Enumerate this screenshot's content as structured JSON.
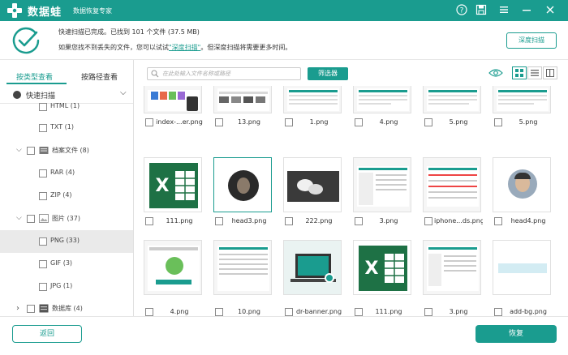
{
  "titlebar": {
    "app_name": "数据蛙",
    "subtitle": "数据恢复专家",
    "help_icon": "help-icon",
    "save_icon": "save-icon",
    "menu_icon": "menu-icon",
    "minimize_icon": "minimize-icon",
    "close_icon": "close-icon"
  },
  "status": {
    "line1": "快速扫描已完成。已找到 101 个文件 (37.5 MB)",
    "line2_prefix": "如果您找不到丢失的文件，您可以试试",
    "line2_link": "\"深度扫描\"",
    "line2_suffix": "。但深度扫描将需要更多时间。",
    "deep_scan_button": "深度扫描"
  },
  "sidebar": {
    "tab_type": "按类型查看",
    "tab_path": "按路径查看",
    "quick_scan": "快速扫描",
    "items": [
      {
        "label": "HTML (1)",
        "indent": 2,
        "selected": false
      },
      {
        "label": "TXT (1)",
        "indent": 2,
        "selected": false
      },
      {
        "label": "档案文件 (8)",
        "indent": 1,
        "selected": false,
        "expanded": true
      },
      {
        "label": "RAR (4)",
        "indent": 2,
        "selected": false
      },
      {
        "label": "ZIP (4)",
        "indent": 2,
        "selected": false
      },
      {
        "label": "图片 (37)",
        "indent": 1,
        "selected": false,
        "expanded": true
      },
      {
        "label": "PNG (33)",
        "indent": 2,
        "selected": true
      },
      {
        "label": "GIF (3)",
        "indent": 2,
        "selected": false
      },
      {
        "label": "JPG (1)",
        "indent": 2,
        "selected": false
      },
      {
        "label": "数据库 (4)",
        "indent": 1,
        "selected": false,
        "expanded": false
      }
    ]
  },
  "toolbar": {
    "search_placeholder": "在此处输入文件名称或路径",
    "filter_button": "筛选器",
    "view_modes": [
      "grid",
      "list",
      "detail"
    ],
    "active_view": "grid"
  },
  "files": {
    "row1": [
      "index-...er.png",
      "13.png",
      "1.png",
      "4.png",
      "5.png",
      "5.png"
    ],
    "row2": [
      "111.png",
      "head3.png",
      "222.png",
      "3.png",
      "iphone...ds.png",
      "head4.png"
    ],
    "row3": [
      "4.png",
      "10.png",
      "dr-banner.png",
      "111.png",
      "3.png",
      "add-bg.png"
    ]
  },
  "footer": {
    "back_button": "返回",
    "recover_button": "恢复"
  },
  "colors": {
    "accent": "#1a9c8f",
    "selected_row": "#eaeaea"
  }
}
